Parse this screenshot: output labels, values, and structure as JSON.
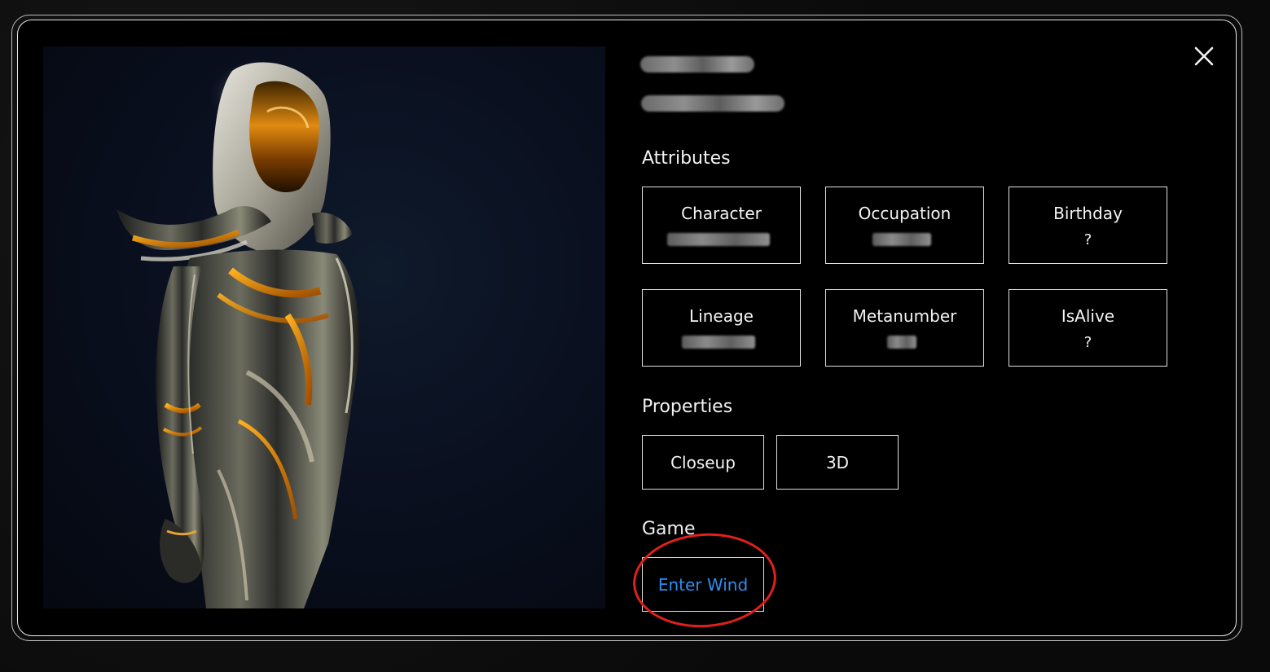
{
  "modal": {
    "close_icon": "close-icon"
  },
  "profile": {
    "name_redacted": true,
    "subtitle_redacted": true
  },
  "attributes": {
    "title": "Attributes",
    "cards": [
      {
        "label": "Character",
        "value": "",
        "redacted": true
      },
      {
        "label": "Occupation",
        "value": "",
        "redacted": true
      },
      {
        "label": "Birthday",
        "value": "?",
        "redacted": false
      },
      {
        "label": "Lineage",
        "value": "",
        "redacted": true
      },
      {
        "label": "Metanumber",
        "value": "",
        "redacted": true
      },
      {
        "label": "IsAlive",
        "value": "?",
        "redacted": false
      }
    ]
  },
  "properties": {
    "title": "Properties",
    "buttons": [
      "Closeup",
      "3D"
    ]
  },
  "game": {
    "title": "Game",
    "enter_label": "Enter Wind",
    "annotation_color": "#e0201b",
    "link_color": "#2f8cf0"
  }
}
